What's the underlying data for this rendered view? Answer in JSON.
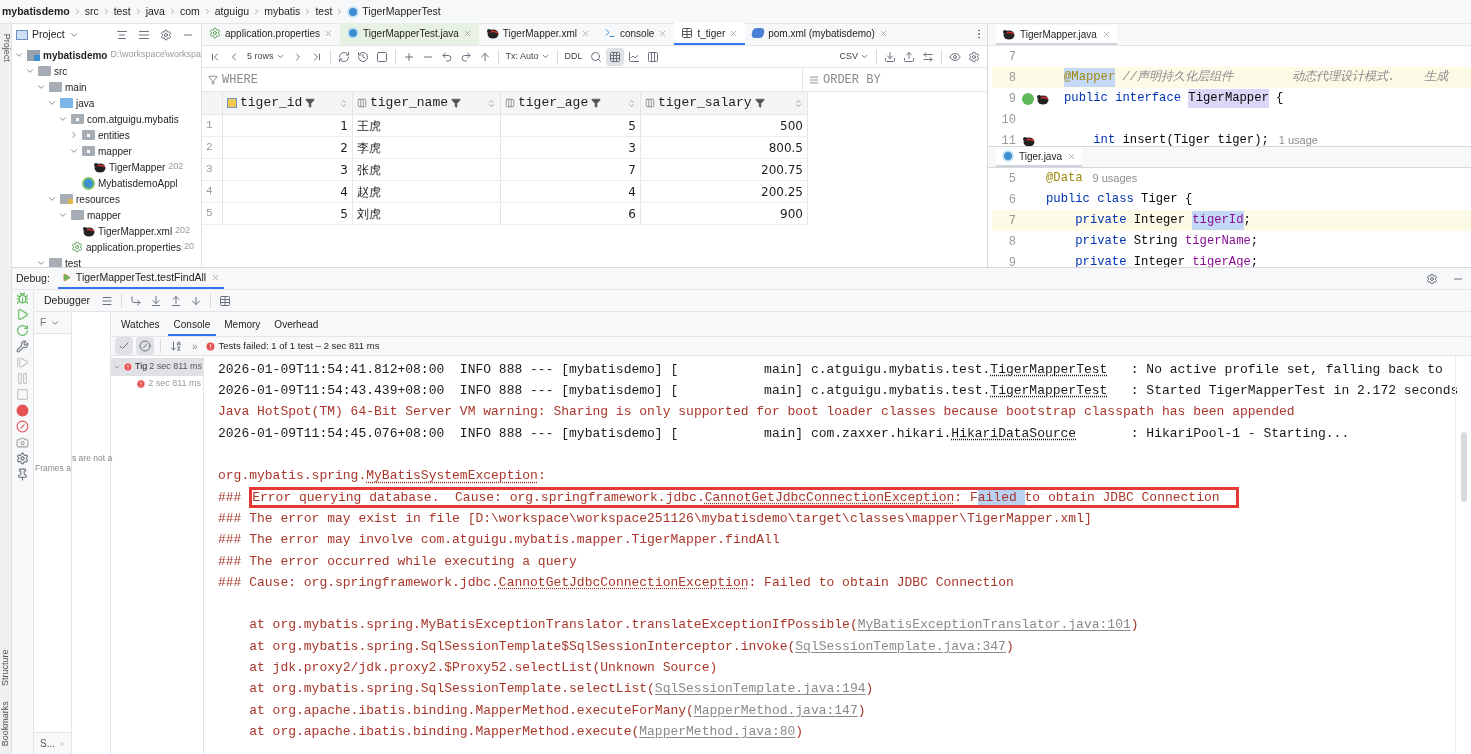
{
  "breadcrumb": [
    "mybatisdemo",
    "src",
    "test",
    "java",
    "com",
    "atguigu",
    "mybatis",
    "test",
    "TigerMapperTest"
  ],
  "side_strip": {
    "top": [
      "Project"
    ],
    "bottom": [
      "Structure",
      "Bookmarks"
    ]
  },
  "project_panel": {
    "title": "Project",
    "tree": [
      {
        "label": "mybatisdemo",
        "hint": "D:\\workspace\\workspa",
        "kind": "module",
        "expanded": true,
        "children": [
          {
            "label": "src",
            "kind": "folder",
            "expanded": true,
            "children": [
              {
                "label": "main",
                "kind": "folder",
                "expanded": true,
                "children": [
                  {
                    "label": "java",
                    "kind": "source",
                    "expanded": true,
                    "children": [
                      {
                        "label": "com.atguigu.mybatis",
                        "kind": "package",
                        "expanded": true,
                        "children": [
                          {
                            "label": "entities",
                            "kind": "package",
                            "expanded": false
                          },
                          {
                            "label": "mapper",
                            "kind": "package",
                            "expanded": true,
                            "children": [
                              {
                                "label": "TigerMapper",
                                "hint": "202",
                                "kind": "mybatis"
                              }
                            ]
                          },
                          {
                            "label": "MybatisdemoAppl",
                            "kind": "spring"
                          }
                        ]
                      }
                    ]
                  },
                  {
                    "label": "resources",
                    "kind": "resources",
                    "expanded": true,
                    "children": [
                      {
                        "label": "mapper",
                        "kind": "folder",
                        "expanded": true,
                        "children": [
                          {
                            "label": "TigerMapper.xml",
                            "hint": "202",
                            "kind": "mybatis"
                          }
                        ]
                      },
                      {
                        "label": "application.properties",
                        "hint": "20",
                        "kind": "properties"
                      }
                    ]
                  }
                ]
              },
              {
                "label": "test",
                "kind": "folder",
                "expanded": true
              }
            ]
          }
        ]
      }
    ]
  },
  "db_tabs": [
    {
      "label": "application.properties",
      "kind": "properties",
      "selected": false
    },
    {
      "label": "TigerMapperTest.java",
      "kind": "class",
      "selected": false
    },
    {
      "label": "TigerMapper.xml",
      "kind": "mybatis",
      "selected": false
    },
    {
      "label": "console",
      "kind": "console",
      "selected": false
    },
    {
      "label": "t_tiger",
      "kind": "table",
      "selected": true
    },
    {
      "label": "pom.xml (mybatisdemo)",
      "kind": "maven",
      "selected": false
    }
  ],
  "db_toolbar": {
    "rows": "5 rows",
    "tx": "Tx: Auto",
    "ddl": "DDL",
    "format": "CSV"
  },
  "filter": {
    "where": "WHERE",
    "order_by": "ORDER BY"
  },
  "table": {
    "columns": [
      {
        "name": "tiger_id",
        "kind": "key"
      },
      {
        "name": "tiger_name",
        "kind": "text"
      },
      {
        "name": "tiger_age",
        "kind": "number"
      },
      {
        "name": "tiger_salary",
        "kind": "number"
      }
    ],
    "rows": [
      {
        "num": "1",
        "cells": [
          "1",
          "王虎",
          "5",
          "500"
        ]
      },
      {
        "num": "2",
        "cells": [
          "2",
          "李虎",
          "3",
          "800.5"
        ]
      },
      {
        "num": "3",
        "cells": [
          "3",
          "张虎",
          "7",
          "200.75"
        ]
      },
      {
        "num": "4",
        "cells": [
          "4",
          "赵虎",
          "4",
          "200.25"
        ]
      },
      {
        "num": "5",
        "cells": [
          "5",
          "刘虎",
          "6",
          "900"
        ]
      }
    ]
  },
  "editor_top": {
    "tab": {
      "label": "TigerMapper.java",
      "kind": "mybatis"
    },
    "lines": [
      {
        "num": "7",
        "current": false
      },
      {
        "num": "8",
        "current": true,
        "tokens": [
          {
            "text": "@Mapper",
            "kind": "annotation_hl"
          },
          {
            "text": "//声明持久化层组件        动态代理设计模式.    生成",
            "kind": "comment"
          }
        ]
      },
      {
        "num": "9",
        "current": false,
        "gutter": [
          {
            "kind": "bean"
          },
          {
            "kind": "mybatis"
          }
        ],
        "tokens": [
          {
            "text": "public interface",
            "kind": "keyword"
          },
          {
            "text": "TigerMapper",
            "kind": "plain_hl"
          },
          {
            "text": "{",
            "kind": "plain"
          }
        ]
      },
      {
        "num": "10",
        "current": false
      },
      {
        "num": "11",
        "current": false,
        "gutter": [
          {
            "kind": "mybatis"
          }
        ],
        "tokens": [
          {
            "text": "int",
            "kind": "keyword_indent"
          },
          {
            "text": "insert(Tiger tiger);",
            "kind": "plain"
          },
          {
            "text": "1 usage",
            "kind": "hint"
          }
        ]
      }
    ]
  },
  "editor_bottom": {
    "tab": {
      "label": "Tiger.java",
      "kind": "class"
    },
    "lines": [
      {
        "num": "5",
        "current": false,
        "tokens": [
          {
            "text": "@Data",
            "kind": "annotation"
          },
          {
            "text": "9 usages",
            "kind": "hint"
          }
        ]
      },
      {
        "num": "6",
        "current": false,
        "tokens": [
          {
            "text": "public class",
            "kind": "keyword"
          },
          {
            "text": "Tiger {",
            "kind": "plain"
          }
        ]
      },
      {
        "num": "7",
        "current": true,
        "tokens": [
          {
            "text": "private",
            "kind": "keyword_indent"
          },
          {
            "text": "Integer",
            "kind": "type"
          },
          {
            "text": "tigerId",
            "kind": "field_hl"
          },
          {
            "text": ";",
            "kind": "punct"
          }
        ]
      },
      {
        "num": "8",
        "current": false,
        "tokens": [
          {
            "text": "private",
            "kind": "keyword_indent"
          },
          {
            "text": "String",
            "kind": "type"
          },
          {
            "text": "tigerName",
            "kind": "field"
          },
          {
            "text": ";",
            "kind": "punct"
          }
        ]
      },
      {
        "num": "9",
        "current": false,
        "tokens": [
          {
            "text": "private",
            "kind": "keyword_indent"
          },
          {
            "text": "Integer",
            "kind": "type"
          },
          {
            "text": "tigerAge",
            "kind": "field"
          },
          {
            "text": ";",
            "kind": "punct"
          }
        ]
      }
    ]
  },
  "debug": {
    "label": "Debug:",
    "tab": "TigerMapperTest.testFindAll",
    "toolbar_title": "Debugger",
    "frames_header": "F",
    "frames_note": "Frames a",
    "threads_note": "s are not a",
    "frames_tab": "S...",
    "tabs": [
      {
        "label": "Watches",
        "selected": false
      },
      {
        "label": "Console",
        "selected": true
      },
      {
        "label": "Memory",
        "selected": false
      },
      {
        "label": "Overhead",
        "selected": false
      }
    ],
    "more": "»",
    "status": "Tests failed: 1 of 1 test – 2 sec 811 ms",
    "tests": [
      {
        "label": "Tig",
        "time": "2 sec 811 ms",
        "failed": true,
        "selected": true,
        "children": [
          {
            "time": "2 sec 811 ms",
            "failed": true,
            "selected": false
          }
        ]
      }
    ]
  },
  "console": {
    "lines": [
      {
        "kind": "info",
        "segments": [
          {
            "kind": "text",
            "text": "2026-01-09T11:54:41.812+08:00  INFO 888 --- [mybatisdemo] [           main] c.atguigu.mybatis.test."
          },
          {
            "kind": "class",
            "text": "TigerMapperTest"
          },
          {
            "kind": "text",
            "text": "   : No active profile set, falling back to"
          }
        ]
      },
      {
        "kind": "info",
        "segments": [
          {
            "kind": "text",
            "text": "2026-01-09T11:54:43.439+08:00  INFO 888 --- [mybatisdemo] [           main] c.atguigu.mybatis.test."
          },
          {
            "kind": "class",
            "text": "TigerMapperTest"
          },
          {
            "kind": "text",
            "text": "   : Started TigerMapperTest in 2.172 seconds"
          }
        ]
      },
      {
        "kind": "error",
        "segments": [
          {
            "kind": "text",
            "text": "Java HotSpot(TM) 64-Bit Server VM warning: Sharing is only supported for boot loader classes because bootstrap classpath has been appended"
          }
        ]
      },
      {
        "kind": "info",
        "segments": [
          {
            "kind": "text",
            "text": "2026-01-09T11:54:45.076+08:00  INFO 888 --- [mybatisdemo] [           main] com.zaxxer.hikari."
          },
          {
            "kind": "class",
            "text": "HikariDataSource"
          },
          {
            "kind": "text",
            "text": "       : HikariPool-1 - Starting..."
          }
        ]
      },
      {
        "kind": "blank"
      },
      {
        "kind": "error",
        "segments": [
          {
            "kind": "text",
            "text": "org.mybatis.spring."
          },
          {
            "kind": "class",
            "text": "MyBatisSystemException"
          },
          {
            "kind": "text",
            "text": ":"
          }
        ]
      },
      {
        "kind": "error",
        "segments": [
          {
            "kind": "text",
            "text": "###"
          },
          {
            "kind": "box",
            "segments": [
              {
                "kind": "text",
                "text": "Error querying database.  Cause: org.springframework.jdbc."
              },
              {
                "kind": "class",
                "text": "CannotGetJdbcConnectionException"
              },
              {
                "kind": "text",
                "text": ": F"
              },
              {
                "kind": "selected",
                "text": "ailed "
              },
              {
                "kind": "text",
                "text": "to obtain JDBC Connection"
              }
            ]
          }
        ]
      },
      {
        "kind": "error",
        "segments": [
          {
            "kind": "text",
            "text": "### The error may exist in file [D:\\workspace\\workspace251126\\mybatisdemo\\target\\classes\\mapper\\TigerMapper.xml]"
          }
        ]
      },
      {
        "kind": "error",
        "segments": [
          {
            "kind": "text",
            "text": "### The error may involve com.atguigu.mybatis.mapper.TigerMapper.findAll"
          }
        ]
      },
      {
        "kind": "error",
        "segments": [
          {
            "kind": "text",
            "text": "### The error occurred while executing a query"
          }
        ]
      },
      {
        "kind": "error",
        "segments": [
          {
            "kind": "text",
            "text": "### Cause: org.springframework.jdbc."
          },
          {
            "kind": "class",
            "text": "CannotGetJdbcConnectionException"
          },
          {
            "kind": "text",
            "text": ": Failed to obtain JDBC Connection"
          }
        ]
      },
      {
        "kind": "blank"
      },
      {
        "kind": "trace",
        "segments": [
          {
            "kind": "text",
            "text": "at org.mybatis.spring.MyBatisExceptionTranslator.translateExceptionIfPossible("
          },
          {
            "kind": "link",
            "text": "MyBatisExceptionTranslator.java:101"
          },
          {
            "kind": "text",
            "text": ")"
          }
        ]
      },
      {
        "kind": "trace",
        "segments": [
          {
            "kind": "text",
            "text": "at org.mybatis.spring.SqlSessionTemplate$SqlSessionInterceptor.invoke("
          },
          {
            "kind": "link",
            "text": "SqlSessionTemplate.java:347"
          },
          {
            "kind": "text",
            "text": ")"
          }
        ]
      },
      {
        "kind": "trace",
        "segments": [
          {
            "kind": "text",
            "text": "at jdk.proxy2/jdk.proxy2.$Proxy52.selectList(Unknown Source)"
          }
        ]
      },
      {
        "kind": "trace",
        "segments": [
          {
            "kind": "text",
            "text": "at org.mybatis.spring.SqlSessionTemplate.selectList("
          },
          {
            "kind": "link",
            "text": "SqlSessionTemplate.java:194"
          },
          {
            "kind": "text",
            "text": ")"
          }
        ]
      },
      {
        "kind": "trace",
        "segments": [
          {
            "kind": "text",
            "text": "at org.apache.ibatis.binding.MapperMethod.executeForMany("
          },
          {
            "kind": "link",
            "text": "MapperMethod.java:147"
          },
          {
            "kind": "text",
            "text": ")"
          }
        ]
      },
      {
        "kind": "trace",
        "segments": [
          {
            "kind": "text",
            "text": "at org.apache.ibatis.binding.MapperMethod.execute("
          },
          {
            "kind": "link",
            "text": "MapperMethod.java:80"
          },
          {
            "kind": "text",
            "text": ")"
          }
        ]
      }
    ]
  }
}
